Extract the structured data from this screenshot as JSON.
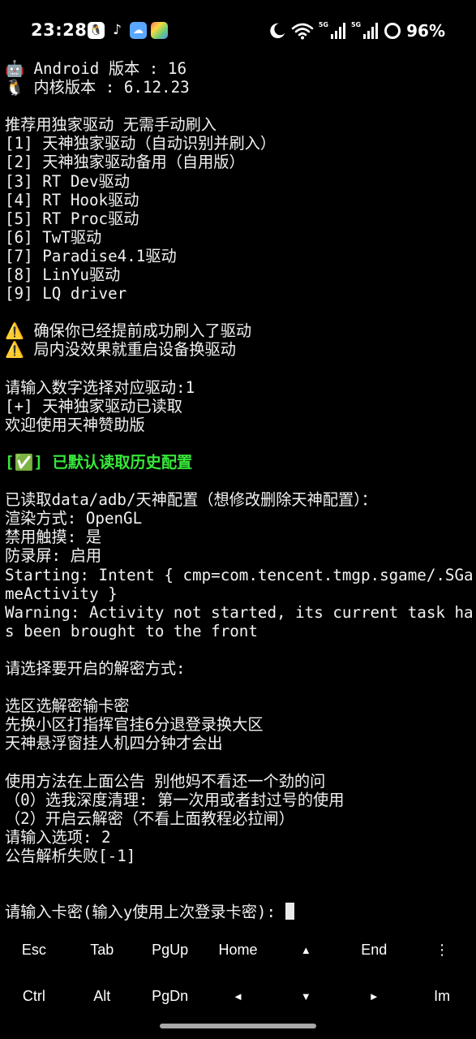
{
  "status_bar": {
    "time": "23:28",
    "notification_icons": [
      "qq-icon",
      "tiktok-icon",
      "weather-icon",
      "photos-icon"
    ],
    "signal_1_label": "5G",
    "signal_2_label": "5G",
    "battery": "96%"
  },
  "terminal": {
    "lines": [
      "🤖 Android 版本 : 16",
      "🐧 内核版本 : 6.12.23",
      "",
      "推荐用独家驱动 无需手动刷入",
      "[1] 天神独家驱动（自动识别并刷入）",
      "[2] 天神独家驱动备用（自用版）",
      "[3] RT Dev驱动",
      "[4] RT Hook驱动",
      "[5] RT Proc驱动",
      "[6] TwT驱动",
      "[7] Paradise4.1驱动",
      "[8] LinYu驱动",
      "[9] LQ driver",
      "",
      "⚠️ 确保你已经提前成功刷入了驱动",
      "⚠️ 局内没效果就重启设备换驱动",
      "",
      "请输入数字选择对应驱动:1",
      "[+] 天神独家驱动已读取",
      "欢迎使用天神赞助版",
      "",
      "[✅] 已默认读取历史配置",
      "",
      "已读取data/adb/天神配置（想修改删除天神配置）：",
      "渲染方式: OpenGL",
      "禁用触摸: 是",
      "防录屏: 启用",
      "Starting: Intent { cmp=com.tencent.tmgp.sgame/.SGameActivity }",
      "Warning: Activity not started, its current task has been brought to the front",
      "",
      "请选择要开启的解密方式:",
      "",
      "选区选解密输卡密",
      "先换小区打指挥官挂6分退登录换大区",
      "天神悬浮窗挂人机四分钟才会出",
      "",
      "使用方法在上面公告 别他妈不看还一个劲的问",
      "（0）选我深度清理: 第一次用或者封过号的使用",
      "（2）开启云解密（不看上面教程必拉闸）",
      "请输入选项: 2",
      "公告解析失败[-1]",
      "",
      "",
      "请输入卡密(输入y使用上次登录卡密): "
    ]
  },
  "extra_keys": {
    "row1": [
      "Esc",
      "Tab",
      "PgUp",
      "Home",
      "▲",
      "End",
      "⋮"
    ],
    "row2": [
      "Ctrl",
      "Alt",
      "PgDn",
      "◄",
      "▼",
      "►",
      "Im"
    ]
  }
}
